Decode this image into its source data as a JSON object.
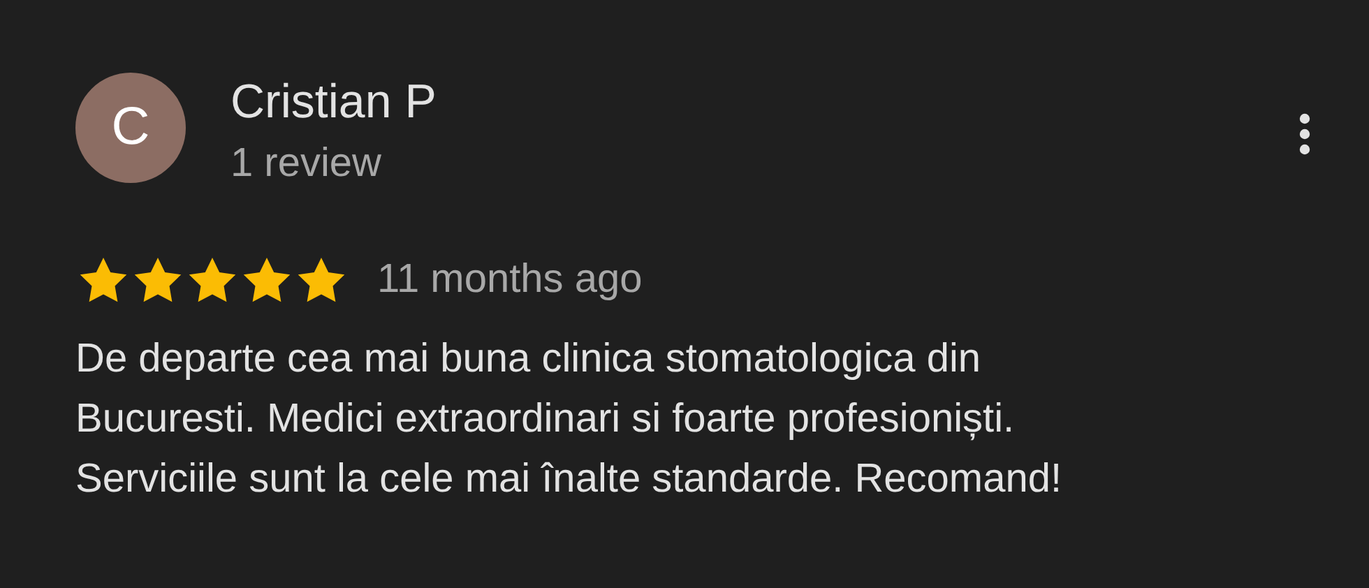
{
  "review": {
    "avatar_letter": "C",
    "author": "Cristian P",
    "author_meta": "1 review",
    "stars": 5,
    "time": "11 months ago",
    "text_lines": [
      "De departe cea mai buna clinica stomatologica din",
      "Bucuresti. Medici extraordinari si foarte profesioniști.",
      "Serviciile sunt la cele mai înalte standarde. Recomand!"
    ]
  }
}
